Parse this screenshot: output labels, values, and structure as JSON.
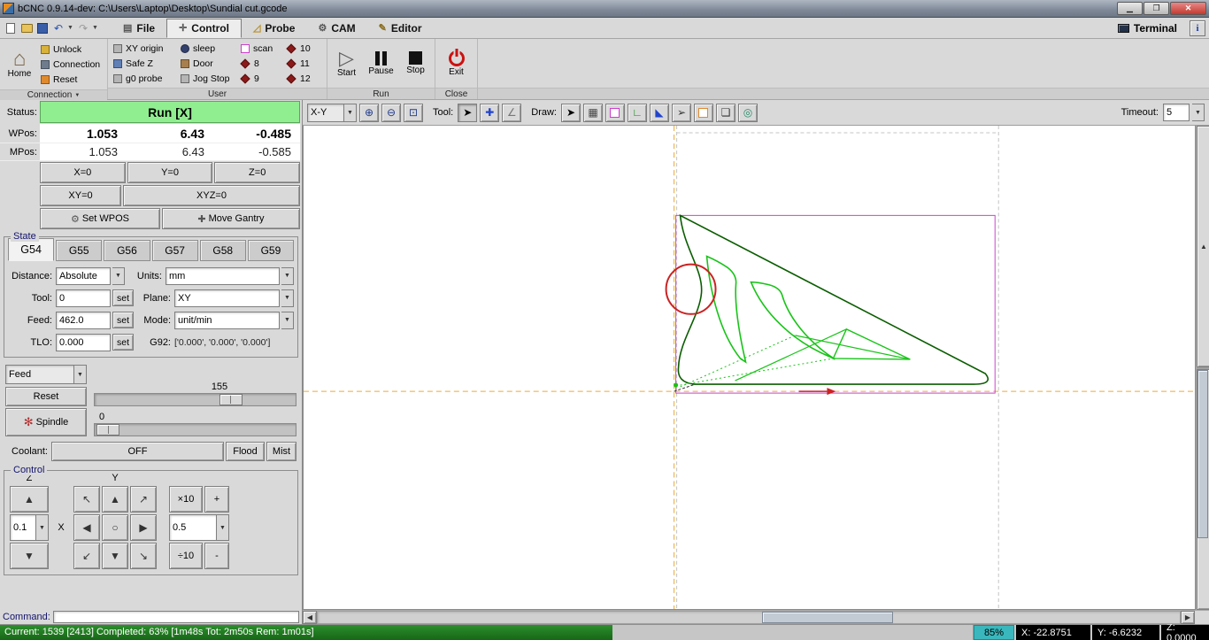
{
  "window": {
    "title": "bCNC 0.9.14-dev: C:\\Users\\Laptop\\Desktop\\Sundial cut.gcode"
  },
  "menubar": {
    "tabs": [
      "File",
      "Control",
      "Probe",
      "CAM",
      "Editor"
    ],
    "active_tab": "Control",
    "terminal": "Terminal",
    "info": "i"
  },
  "ribbon": {
    "connection": {
      "label": "Connection",
      "home": "Home",
      "unlock": "Unlock",
      "connect": "Connection",
      "reset": "Reset"
    },
    "user": {
      "label": "User",
      "buttons": [
        "XY origin",
        "Safe Z",
        "g0 probe",
        "sleep",
        "Door",
        "Jog Stop",
        "scan",
        "8",
        "9",
        "10",
        "11",
        "12"
      ]
    },
    "run": {
      "label": "Run",
      "start": "Start",
      "pause": "Pause",
      "stop": "Stop"
    },
    "close": {
      "label": "Close",
      "exit": "Exit"
    }
  },
  "dro": {
    "status_label": "Status:",
    "status": "Run [X]",
    "wpos_label": "WPos:",
    "mpos_label": "MPos:",
    "wpos": [
      "1.053",
      "6.43",
      "-0.485"
    ],
    "mpos": [
      "1.053",
      "6.43",
      "-0.585"
    ],
    "x0": "X=0",
    "y0": "Y=0",
    "z0": "Z=0",
    "xy0": "XY=0",
    "xyz0": "XYZ=0",
    "set_wpos": "Set WPOS",
    "move_gantry": "Move Gantry"
  },
  "state": {
    "label": "State",
    "tabs": [
      "G54",
      "G55",
      "G56",
      "G57",
      "G58",
      "G59"
    ],
    "active": "G54",
    "distance_label": "Distance:",
    "distance": "Absolute",
    "units_label": "Units:",
    "units": "mm",
    "tool_label": "Tool:",
    "tool": "0",
    "set": "set",
    "plane_label": "Plane:",
    "plane": "XY",
    "feed_label": "Feed:",
    "feed": "462.0",
    "mode_label": "Mode:",
    "mode": "unit/min",
    "tlo_label": "TLO:",
    "tlo": "0.000",
    "g92_label": "G92:",
    "g92": "['0.000', '0.000', '0.000']"
  },
  "overrides": {
    "feed_combo": "Feed",
    "feed_value": "155",
    "reset": "Reset",
    "spindle": "Spindle",
    "spindle_value": "0",
    "coolant_label": "Coolant:",
    "off": "OFF",
    "flood": "Flood",
    "mist": "Mist"
  },
  "control": {
    "label": "Control",
    "z": "Z",
    "y": "Y",
    "x": "X",
    "z_step": "0.1",
    "xy_step": "0.5",
    "times10": "×10",
    "plus": "+",
    "div10": "÷10",
    "minus": "-",
    "command_label": "Command:"
  },
  "canvas": {
    "view": "X-Y",
    "tool_label": "Tool:",
    "draw_label": "Draw:",
    "timeout_label": "Timeout:",
    "timeout": "5"
  },
  "statusbar": {
    "progress": "Current: 1539 [2413]  Completed: 63% [1m48s Tot: 2m50s Rem: 1m01s]",
    "percent": 63,
    "zoom": "85%",
    "x": "X: -22.8751",
    "y": "Y: -6.6232",
    "z": "Z: 0.0000"
  },
  "colors": {
    "status_green": "#90ee90",
    "path_dark_green": "#0a5d00",
    "path_light_green": "#18c418",
    "marker_red": "#cc2222",
    "margin_magenta": "#cc44cc",
    "crosshair_orange": "#f0a830"
  }
}
